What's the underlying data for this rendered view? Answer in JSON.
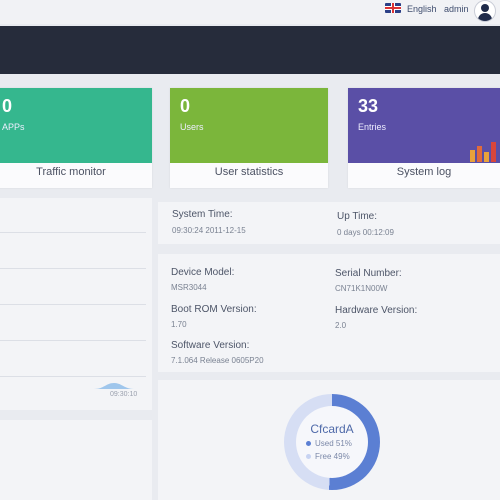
{
  "header": {
    "language": "English",
    "user": "admin"
  },
  "cards": [
    {
      "value": "0",
      "caption": "APPs",
      "title": "Traffic monitor",
      "color": "#35b78e"
    },
    {
      "value": "0",
      "caption": "Users",
      "title": "User statistics",
      "color": "#7bb63b"
    },
    {
      "value": "33",
      "caption": "Entries",
      "title": "System log",
      "color": "#5a4fa6"
    }
  ],
  "traffic_chart": {
    "time_label": "09:30:10"
  },
  "system": {
    "system_time_label": "System Time:",
    "system_time_value": "09:30:24 2011-12-15",
    "up_time_label": "Up Time:",
    "up_time_value": "0 days 00:12:09"
  },
  "device": {
    "model_label": "Device Model:",
    "model_value": "MSR3044",
    "serial_label": "Serial Number:",
    "serial_value": "CN71K1N00W",
    "bootrom_label": "Boot ROM Version:",
    "bootrom_value": "1.70",
    "hardware_label": "Hardware Version:",
    "hardware_value": "2.0",
    "software_label": "Software Version:",
    "software_value": "7.1.064 Release 0605P20"
  },
  "storage": {
    "name": "CfcardA",
    "used_label": "Used 51%",
    "free_label": "Free 49%",
    "used_fraction": 0.51,
    "used_color": "#5b7fd3",
    "free_color": "#c7d3f2"
  }
}
